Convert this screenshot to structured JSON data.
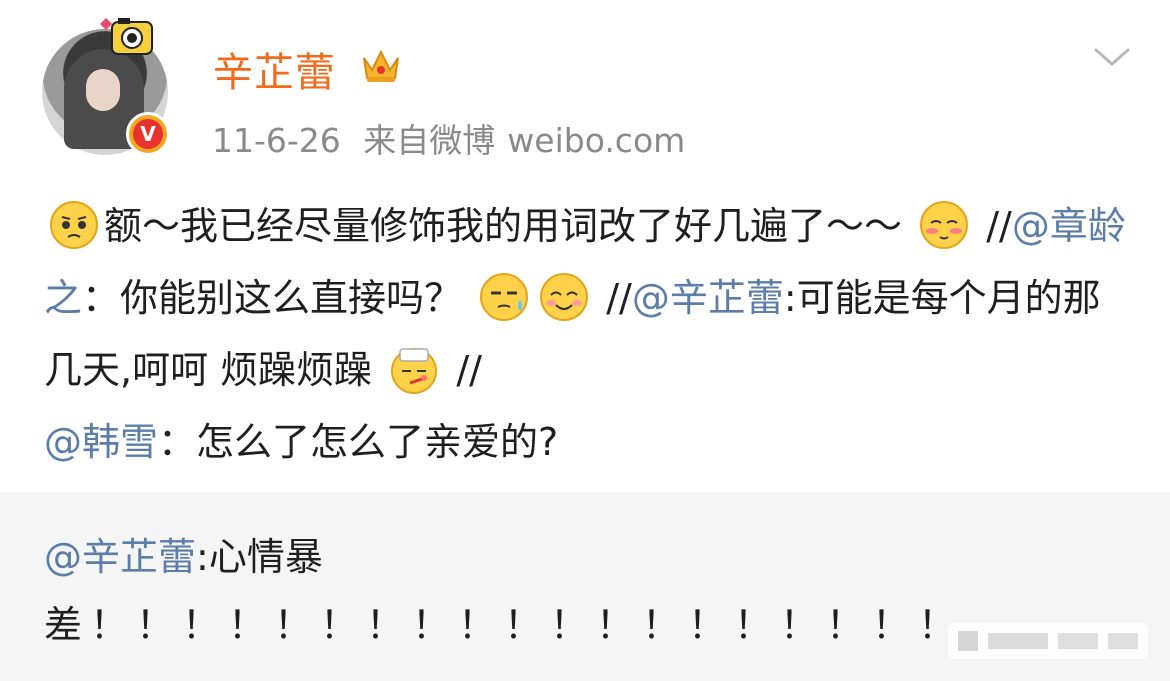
{
  "post": {
    "username": "辛芷蕾",
    "date": "11-6-26",
    "source_prefix": "来自微博",
    "source": "weibo.com",
    "segments": {
      "t1": "额～我已经尽量修饰我的用词改了好几遍了～～",
      "t2": "//",
      "m1": "@章龄之",
      "t3": "：你能别这么直接吗？",
      "t4": "//",
      "m2": "@辛芷蕾",
      "t5": ":可能是每个月的那几天,呵呵 烦躁烦躁",
      "t6": "//",
      "m3": "@韩雪",
      "t7": "：怎么了怎么了亲爱的?"
    },
    "emoji_names": [
      "awkward-emoji",
      "shy-emoji",
      "sweat-emoji",
      "smile-emoji",
      "sick-emoji"
    ]
  },
  "retweet": {
    "mention": "@辛芷蕾",
    "text_line1": ":心情暴",
    "text_line2": "差！！！！！！！！！！！！！！！！！！！"
  },
  "colors": {
    "username": "#f26a1b",
    "link": "#5b7da7",
    "meta": "#8a8a8a",
    "retweet_bg": "#f5f5f5"
  }
}
